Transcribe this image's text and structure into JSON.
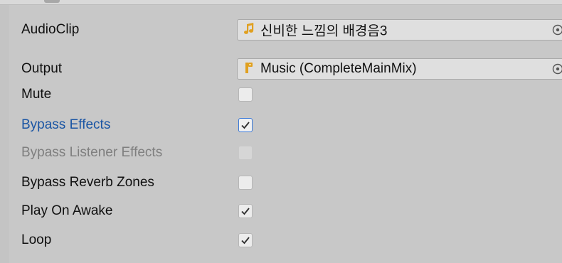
{
  "properties": {
    "audioclip": {
      "label": "AudioClip",
      "value": "신비한 느낌의 배경음3",
      "icon": "music-note-icon"
    },
    "output": {
      "label": "Output",
      "value": "Music (CompleteMainMix)",
      "icon": "audio-mixer-group-icon"
    },
    "mute": {
      "label": "Mute",
      "checked": false
    },
    "bypass_effects": {
      "label": "Bypass Effects",
      "checked": true
    },
    "bypass_listener_effects": {
      "label": "Bypass Listener Effects",
      "checked": false,
      "disabled": true
    },
    "bypass_reverb_zones": {
      "label": "Bypass Reverb Zones",
      "checked": false
    },
    "play_on_awake": {
      "label": "Play On Awake",
      "checked": true
    },
    "loop": {
      "label": "Loop",
      "checked": true
    }
  },
  "colors": {
    "background": "#c8c8c8",
    "highlight_label": "#1a55a4",
    "disabled_label": "#7f7f7f",
    "focus_border": "#3a79d8",
    "asset_icon": "#e0a020"
  }
}
